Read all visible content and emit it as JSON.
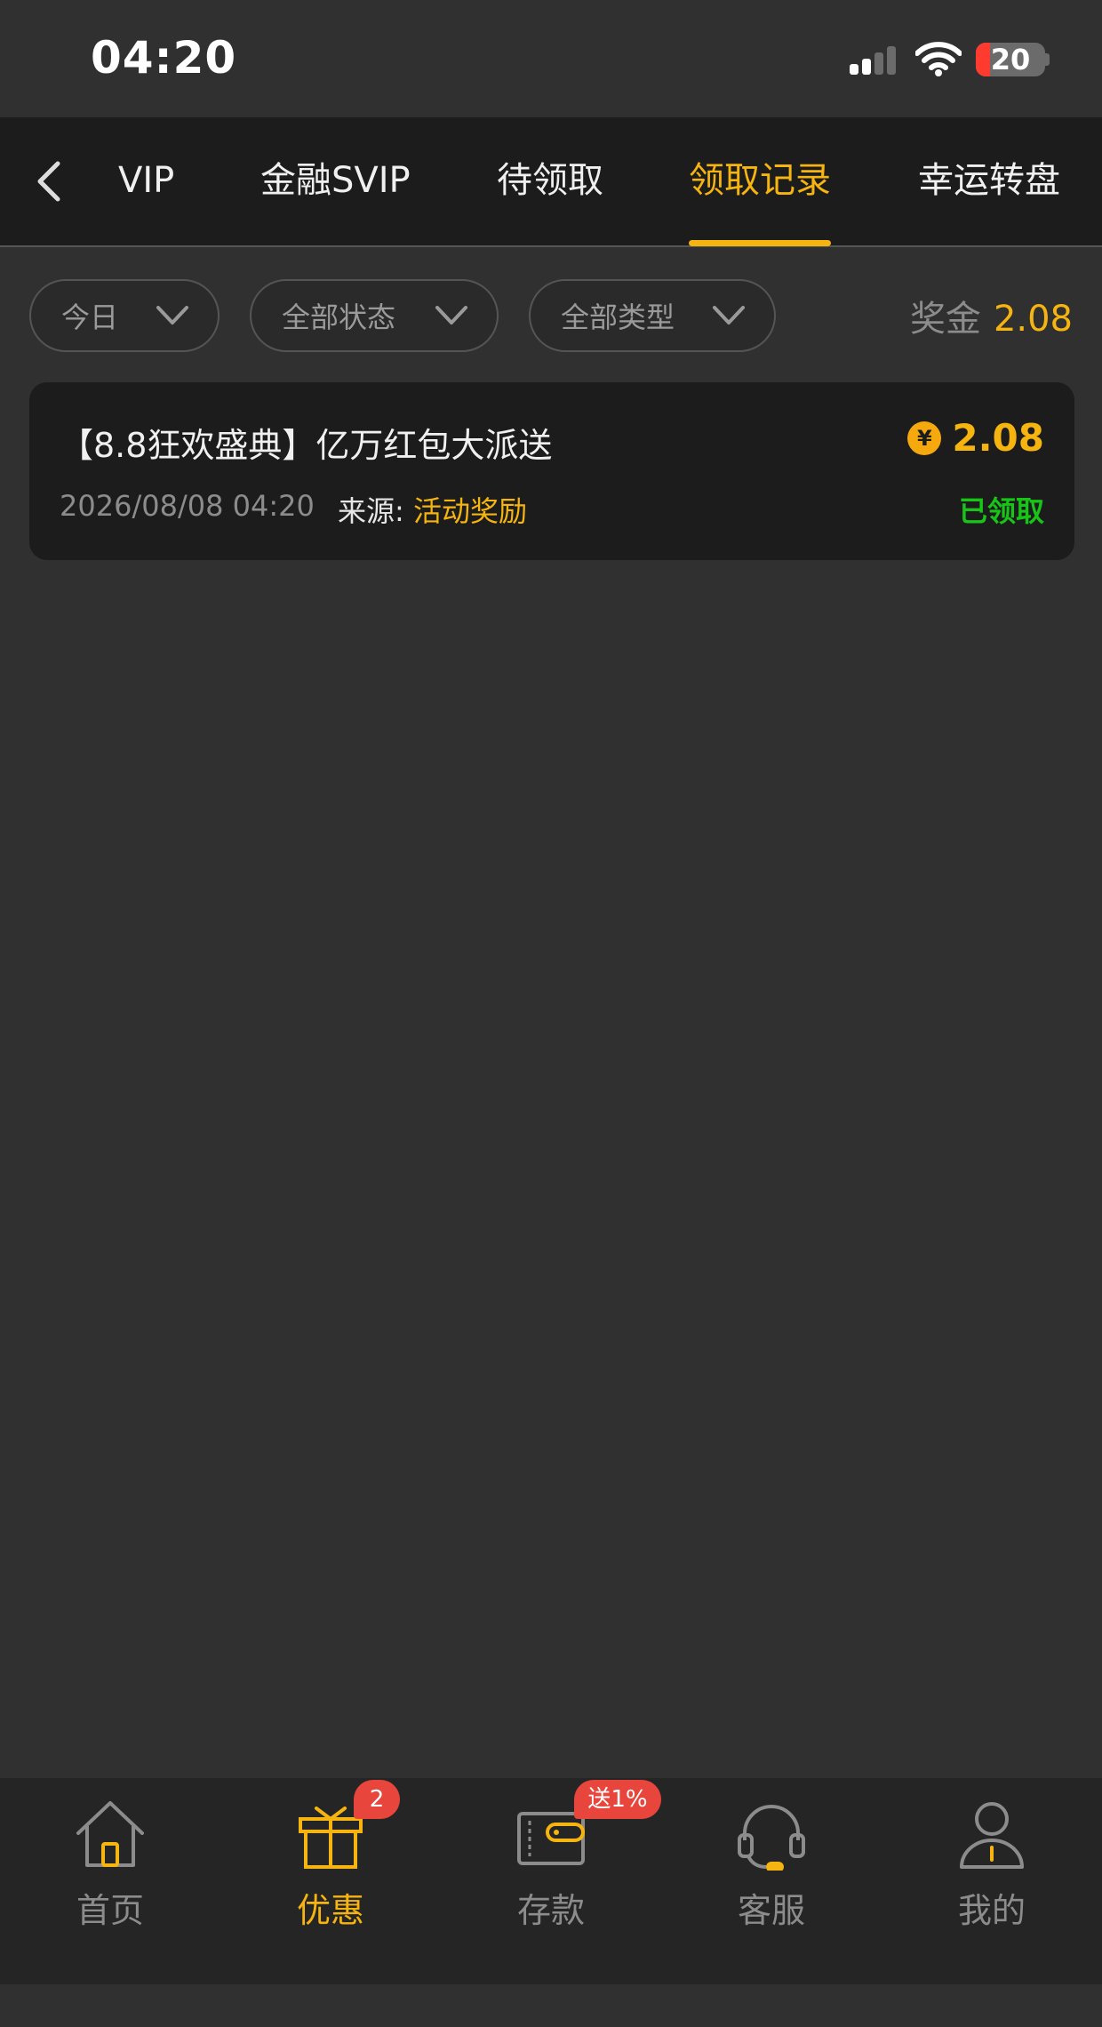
{
  "status_bar": {
    "time": "04:20",
    "battery": "20",
    "battery_level": 0.2
  },
  "tabs": [
    {
      "label": "VIP",
      "active": false
    },
    {
      "label": "金融SVIP",
      "active": false
    },
    {
      "label": "待领取",
      "active": false
    },
    {
      "label": "领取记录",
      "active": true
    },
    {
      "label": "幸运转盘",
      "active": false
    }
  ],
  "filters": {
    "date": "今日",
    "status": "全部状态",
    "type": "全部类型"
  },
  "bonus": {
    "label": "奖金",
    "value": "2.08"
  },
  "records": [
    {
      "title": "【8.8狂欢盛典】亿万红包大派送",
      "amount": "2.08",
      "coin_symbol": "¥",
      "date": "2026/08/08 04:20",
      "source_label": "来源:",
      "source_value": "活动奖励",
      "status": "已领取"
    }
  ],
  "bottom_nav": {
    "items": [
      {
        "label": "首页",
        "icon": "home-icon",
        "active": false
      },
      {
        "label": "优惠",
        "icon": "gift-icon",
        "active": true
      },
      {
        "label": "存款",
        "icon": "wallet-icon",
        "active": false
      },
      {
        "label": "客服",
        "icon": "headset-icon",
        "active": false
      },
      {
        "label": "我的",
        "icon": "user-icon",
        "active": false
      }
    ],
    "promo_badge": "2",
    "deposit_badge": "送1%"
  },
  "colors": {
    "accent": "#f5b40f",
    "success": "#17c417",
    "badge": "#e8453c",
    "background": "#303030",
    "surface": "#1c1c1c"
  }
}
